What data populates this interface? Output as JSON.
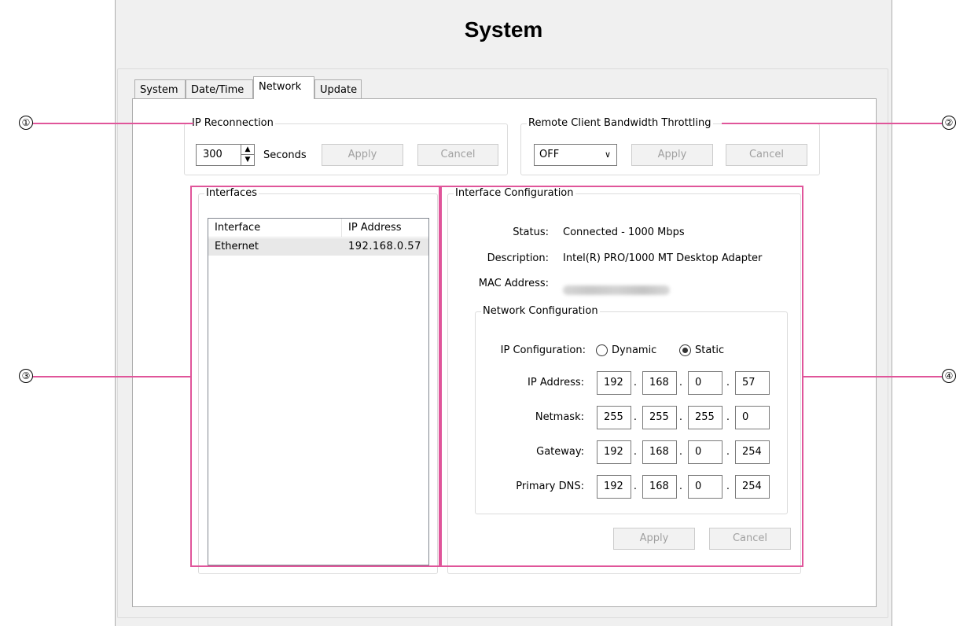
{
  "window": {
    "title": "System"
  },
  "tabs": [
    {
      "label": "System"
    },
    {
      "label": "Date/Time"
    },
    {
      "label": "Network"
    },
    {
      "label": "Update"
    }
  ],
  "active_tab": "Network",
  "ip_reconnection": {
    "group_label": "IP Reconnection",
    "value": "300",
    "unit_label": "Seconds",
    "apply_label": "Apply",
    "cancel_label": "Cancel"
  },
  "bandwidth": {
    "group_label": "Remote Client Bandwidth Throttling",
    "selected": "OFF",
    "apply_label": "Apply",
    "cancel_label": "Cancel"
  },
  "interfaces": {
    "group_label": "Interfaces",
    "columns": [
      "Interface",
      "IP Address"
    ],
    "rows": [
      {
        "interface": "Ethernet",
        "ip": "192.168.0.57"
      }
    ]
  },
  "interface_config": {
    "group_label": "Interface Configuration",
    "status_label": "Status:",
    "status_value": "Connected - 1000 Mbps",
    "description_label": "Description:",
    "description_value": "Intel(R) PRO/1000 MT Desktop Adapter",
    "mac_label": "MAC Address:",
    "network_config": {
      "group_label": "Network Configuration",
      "ip_config_label": "IP Configuration:",
      "dynamic_label": "Dynamic",
      "static_label": "Static",
      "selected_mode": "Static",
      "ip_address_label": "IP Address:",
      "ip_address": [
        "192",
        "168",
        "0",
        "57"
      ],
      "netmask_label": "Netmask:",
      "netmask": [
        "255",
        "255",
        "255",
        "0"
      ],
      "gateway_label": "Gateway:",
      "gateway": [
        "192",
        "168",
        "0",
        "254"
      ],
      "dns_label": "Primary DNS:",
      "dns": [
        "192",
        "168",
        "0",
        "254"
      ]
    },
    "apply_label": "Apply",
    "cancel_label": "Cancel"
  },
  "callouts": {
    "c1": "①",
    "c2": "②",
    "c3": "③",
    "c4": "④"
  },
  "colors": {
    "callout": "#e0559a",
    "disabled_text": "#a0a0a0",
    "selected_row": "#e8e8e8"
  }
}
